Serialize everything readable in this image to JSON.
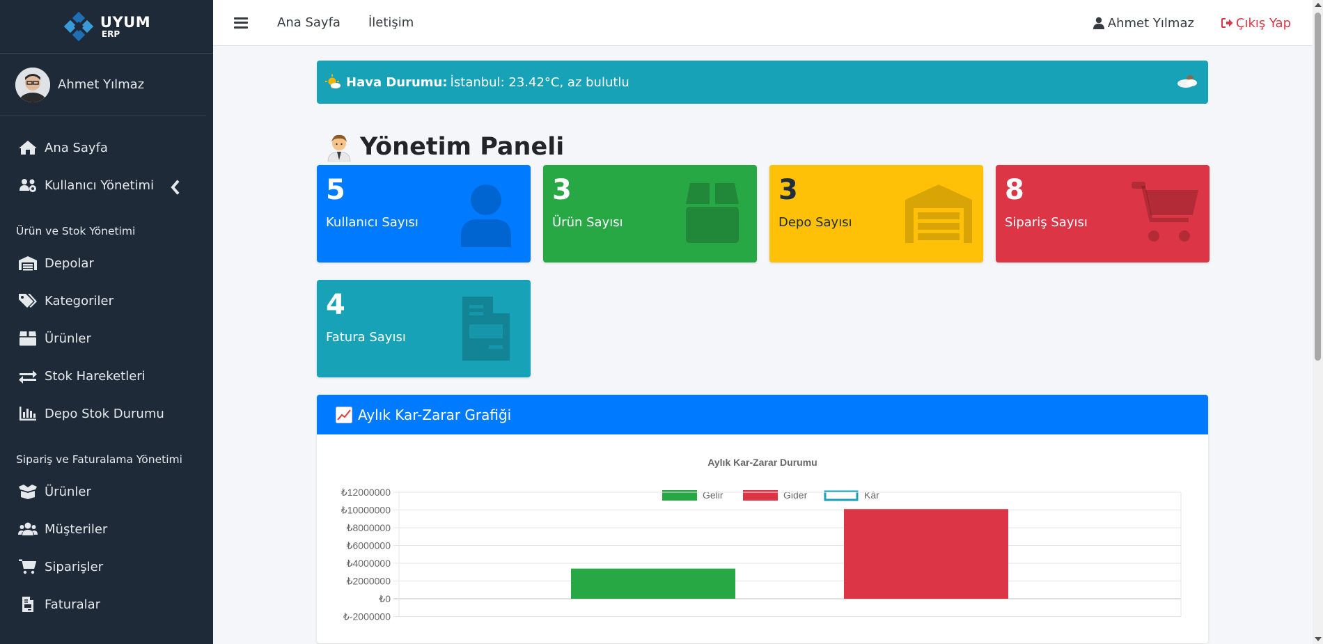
{
  "brand": {
    "name": "UYUM",
    "sub": "ERP"
  },
  "user": {
    "name": "Ahmet Yılmaz"
  },
  "sidebar": {
    "main_items": [
      {
        "label": "Ana Sayfa",
        "icon": "home-icon"
      },
      {
        "label": "Kullanıcı Yönetimi",
        "icon": "users-cog-icon"
      }
    ],
    "section1": {
      "header": "Ürün ve Stok Yönetimi",
      "items": [
        {
          "label": "Depolar",
          "icon": "warehouse-icon"
        },
        {
          "label": "Kategoriler",
          "icon": "tags-icon"
        },
        {
          "label": "Ürünler",
          "icon": "box-icon"
        },
        {
          "label": "Stok Hareketleri",
          "icon": "exchange-icon"
        },
        {
          "label": "Depo Stok Durumu",
          "icon": "chart-bar-icon"
        }
      ]
    },
    "section2": {
      "header": "Sipariş ve Faturalama Yönetimi",
      "items": [
        {
          "label": "Ürünler",
          "icon": "box-open-icon"
        },
        {
          "label": "Müşteriler",
          "icon": "users-icon"
        },
        {
          "label": "Siparişler",
          "icon": "cart-icon"
        },
        {
          "label": "Faturalar",
          "icon": "invoice-icon"
        }
      ]
    }
  },
  "topbar": {
    "links": [
      "Ana Sayfa",
      "İletişim"
    ],
    "user": "Ahmet Yılmaz",
    "logout": "Çıkış Yap"
  },
  "weather": {
    "label": "Hava Durumu:",
    "text": "İstanbul: 23.42°C, az bulutlu"
  },
  "page_title": "Yönetim Paneli",
  "cards": [
    {
      "value": "5",
      "label": "Kullanıcı Sayısı",
      "color": "#007bff",
      "icon": "user-icon"
    },
    {
      "value": "3",
      "label": "Ürün Sayısı",
      "color": "#28a745",
      "icon": "box-icon"
    },
    {
      "value": "3",
      "label": "Depo Sayısı",
      "color": "#ffc107",
      "icon": "warehouse-icon"
    },
    {
      "value": "8",
      "label": "Sipariş Sayısı",
      "color": "#dc3545",
      "icon": "cart-icon"
    },
    {
      "value": "4",
      "label": "Fatura Sayısı",
      "color": "#17a2b8",
      "icon": "invoice-icon"
    }
  ],
  "chart_panel": {
    "title": "Aylık Kar-Zarar Grafiği"
  },
  "chart_data": {
    "type": "bar",
    "title": "Aylık Kar-Zarar Durumu",
    "legend_position": "top",
    "series": [
      {
        "name": "Gelir",
        "value": 3400000,
        "color": "#28a745",
        "style": "filled"
      },
      {
        "name": "Gider",
        "value": 10100000,
        "color": "#dc3545",
        "style": "filled"
      },
      {
        "name": "Kâr",
        "value": null,
        "color": "#17a2b8",
        "style": "outline"
      }
    ],
    "y_ticks": [
      12000000,
      10000000,
      8000000,
      6000000,
      4000000,
      2000000,
      0,
      -2000000
    ],
    "y_tick_labels": [
      "₺12000000",
      "₺10000000",
      "₺8000000",
      "₺6000000",
      "₺4000000",
      "₺2000000",
      "₺0",
      "₺-2000000"
    ],
    "ylim": [
      -2000000,
      12000000
    ],
    "grid": true
  }
}
